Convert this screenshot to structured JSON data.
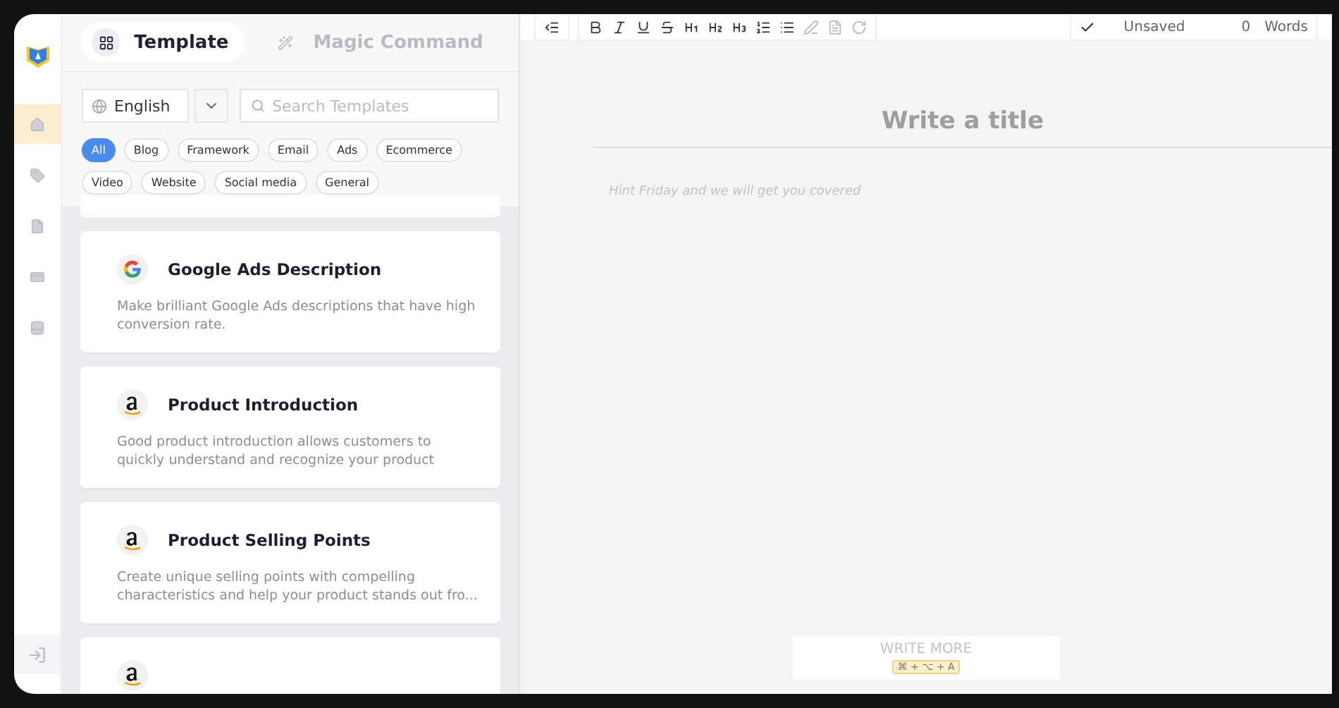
{
  "rail": {
    "items": [
      {
        "kind": "home",
        "selected": true
      },
      {
        "kind": "tag",
        "selected": false
      },
      {
        "kind": "file",
        "selected": false
      },
      {
        "kind": "card",
        "selected": false
      },
      {
        "kind": "database",
        "selected": false
      }
    ]
  },
  "tabs": [
    {
      "label": "Template",
      "kind": "grid",
      "selected": true
    },
    {
      "label": "Magic Command",
      "kind": "wand",
      "selected": false
    }
  ],
  "language": {
    "value": "English"
  },
  "search": {
    "placeholder": "Search Templates"
  },
  "categories": [
    {
      "label": "All",
      "selected": true
    },
    {
      "label": "Blog",
      "selected": false
    },
    {
      "label": "Framework",
      "selected": false
    },
    {
      "label": "Email",
      "selected": false
    },
    {
      "label": "Ads",
      "selected": false
    },
    {
      "label": "Ecommerce",
      "selected": false
    },
    {
      "label": "Video",
      "selected": false
    },
    {
      "label": "Website",
      "selected": false
    },
    {
      "label": "Social media",
      "selected": false
    },
    {
      "label": "General",
      "selected": false
    }
  ],
  "templates": [
    {
      "kind": "google",
      "title": "Google Ads Description",
      "description": "Make brilliant Google Ads descriptions that have high conversion rate."
    },
    {
      "kind": "amazon",
      "title": "Product Introduction",
      "description": "Good product introduction allows customers to quickly understand and recognize your product"
    },
    {
      "kind": "amazon",
      "title": "Product Selling Points",
      "description": "Create unique selling points with compelling characteristics and help your product stands out fro..."
    },
    {
      "kind": "amazon"
    }
  ],
  "editor": {
    "title_placeholder": "Write a title",
    "body_placeholder": "Hint Friday and we will get you covered",
    "status": "Unsaved",
    "word_count": "0",
    "word_label": "Words",
    "write_more": {
      "label": "WRITE MORE",
      "shortcut": "⌘ + ⌥ + A"
    }
  }
}
